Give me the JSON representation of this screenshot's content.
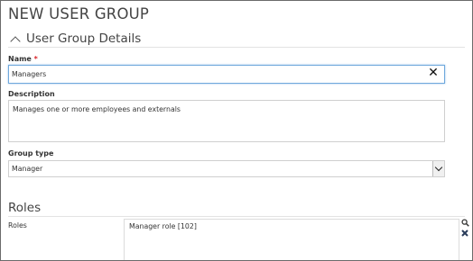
{
  "page": {
    "title": "NEW USER GROUP"
  },
  "details_section": {
    "title": "User Group Details"
  },
  "name": {
    "label": "Name",
    "required_mark": "*",
    "value": "Managers"
  },
  "description": {
    "label": "Description",
    "value": "Manages one or more employees and externals"
  },
  "group_type": {
    "label": "Group type",
    "selected": "Manager"
  },
  "roles_section": {
    "title": "Roles"
  },
  "roles": {
    "label": "Roles",
    "items": [
      "Manager role [102]"
    ]
  },
  "icons": {
    "collapse": "chevron-up-icon",
    "clear": "close-icon",
    "dropdown": "chevron-down-icon",
    "search": "search-icon",
    "remove": "remove-icon"
  },
  "colors": {
    "required": "#d9242a",
    "focus_border": "#6fa8dc"
  }
}
